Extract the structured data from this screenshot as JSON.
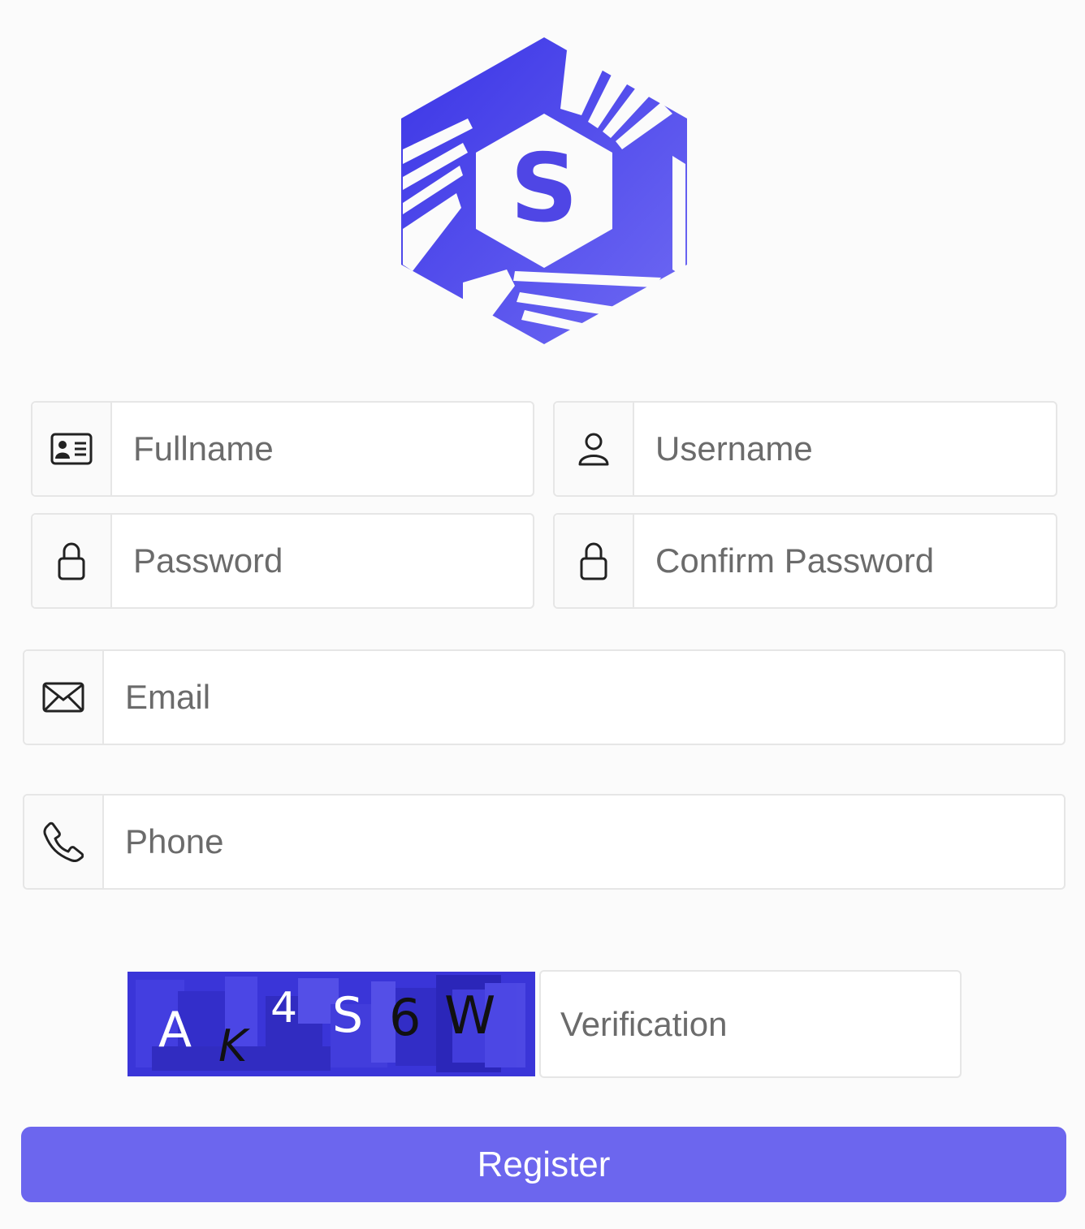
{
  "brand": {
    "logo_icon": "hexagon-s-logo",
    "logo_letter": "S",
    "primary_color": "#4f46e5",
    "accent_color": "#6c66ee"
  },
  "form": {
    "fullname": {
      "placeholder": "Fullname",
      "icon": "id-card-icon"
    },
    "username": {
      "placeholder": "Username",
      "icon": "user-icon"
    },
    "password": {
      "placeholder": "Password",
      "icon": "lock-icon"
    },
    "confirm_password": {
      "placeholder": "Confirm Password",
      "icon": "lock-icon"
    },
    "email": {
      "placeholder": "Email",
      "icon": "envelope-icon"
    },
    "phone": {
      "placeholder": "Phone",
      "icon": "phone-icon"
    },
    "captcha": {
      "chars": [
        "A",
        "K",
        "4",
        "S",
        "6",
        "W"
      ]
    },
    "verification": {
      "placeholder": "Verification"
    },
    "register_label": "Register"
  }
}
